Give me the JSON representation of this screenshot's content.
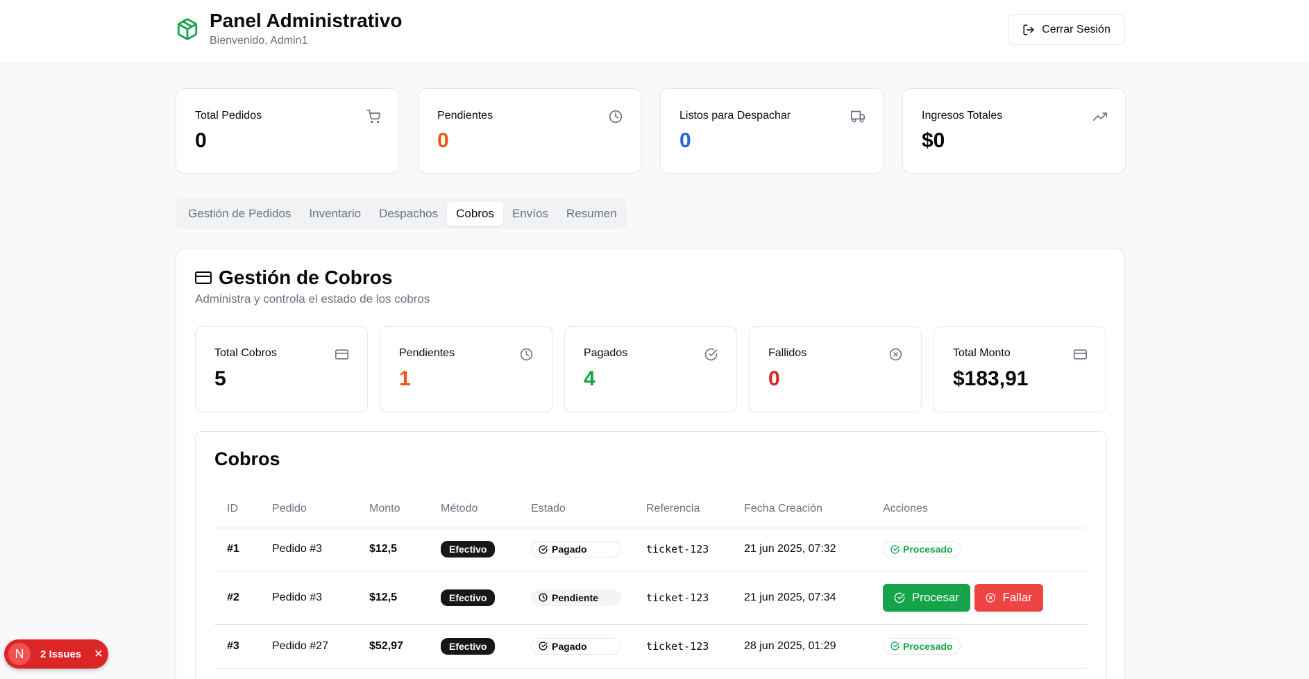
{
  "header": {
    "title": "Panel Administrativo",
    "subtitle": "Bienvenido, Admin1",
    "logout_label": "Cerrar Sesión",
    "logo_color": "#16a34a"
  },
  "stats": [
    {
      "label": "Total Pedidos",
      "value": "0",
      "icon": "cart-icon",
      "color": "#0a0a0a"
    },
    {
      "label": "Pendientes",
      "value": "0",
      "icon": "clock-icon",
      "color": "#ea580c"
    },
    {
      "label": "Listos para Despachar",
      "value": "0",
      "icon": "truck-icon",
      "color": "#2563eb"
    },
    {
      "label": "Ingresos Totales",
      "value": "$0",
      "icon": "trending-up-icon",
      "color": "#0a0a0a"
    }
  ],
  "tabs": [
    {
      "label": "Gestión de Pedidos",
      "active": false
    },
    {
      "label": "Inventario",
      "active": false
    },
    {
      "label": "Despachos",
      "active": false
    },
    {
      "label": "Cobros",
      "active": true
    },
    {
      "label": "Envíos",
      "active": false
    },
    {
      "label": "Resumen",
      "active": false
    }
  ],
  "panel": {
    "title": "Gestión de Cobros",
    "subtitle": "Administra y controla el estado de los cobros"
  },
  "mini_stats": [
    {
      "label": "Total Cobros",
      "value": "5",
      "icon": "credit-card-icon",
      "color": "#0a0a0a"
    },
    {
      "label": "Pendientes",
      "value": "1",
      "icon": "clock-icon",
      "color": "#ea580c"
    },
    {
      "label": "Pagados",
      "value": "4",
      "icon": "check-circle-icon",
      "color": "#16a34a"
    },
    {
      "label": "Fallidos",
      "value": "0",
      "icon": "x-circle-icon",
      "color": "#dc2626"
    },
    {
      "label": "Total Monto",
      "value": "$183,91",
      "icon": "credit-card-icon",
      "color": "#0a0a0a"
    }
  ],
  "table": {
    "title": "Cobros",
    "columns": [
      "ID",
      "Pedido",
      "Monto",
      "Método",
      "Estado",
      "Referencia",
      "Fecha Creación",
      "Acciones"
    ],
    "rows": [
      {
        "id": "#1",
        "pedido": "Pedido #3",
        "monto": "$12,5",
        "metodo": "Efectivo",
        "estado": "Pagado",
        "referencia": "ticket-123",
        "fecha": "21 jun 2025, 07:32",
        "accion": "Procesado"
      },
      {
        "id": "#2",
        "pedido": "Pedido #3",
        "monto": "$12,5",
        "metodo": "Efectivo",
        "estado": "Pendiente",
        "referencia": "ticket-123",
        "fecha": "21 jun 2025, 07:34",
        "accion_procesar": "Procesar",
        "accion_fallar": "Fallar"
      },
      {
        "id": "#3",
        "pedido": "Pedido #27",
        "monto": "$52,97",
        "metodo": "Efectivo",
        "estado": "Pagado",
        "referencia": "ticket-123",
        "fecha": "28 jun 2025, 01:29",
        "accion": "Procesado"
      }
    ]
  },
  "issues_badge": {
    "letter": "N",
    "label": "2 Issues"
  }
}
